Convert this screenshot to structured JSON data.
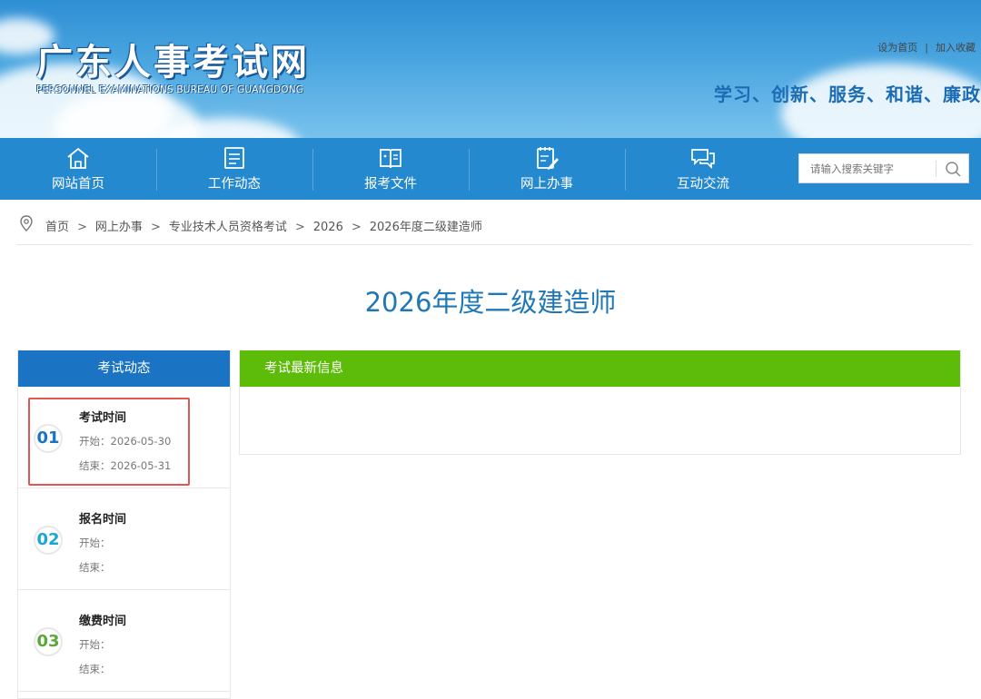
{
  "header": {
    "title": "广东人事考试网",
    "subtitle": "PERSONNEL EXAMINATIONS BUREAU OF GUANGDONG",
    "links": [
      "设为首页",
      "加入收藏"
    ],
    "link_sep": "|",
    "slogan": "学习、创新、服务、和谐、廉政"
  },
  "nav": {
    "items": [
      {
        "label": "网站首页",
        "icon": "home-icon"
      },
      {
        "label": "工作动态",
        "icon": "list-icon"
      },
      {
        "label": "报考文件",
        "icon": "book-icon"
      },
      {
        "label": "网上办事",
        "icon": "edit-doc-icon"
      },
      {
        "label": "互动交流",
        "icon": "chat-icon"
      }
    ],
    "search_placeholder": "请输入搜索关键字"
  },
  "breadcrumb": {
    "items": [
      "首页",
      "网上办事",
      "专业技术人员资格考试",
      "2026",
      "2026年度二级建造师"
    ],
    "sep": ">"
  },
  "page_title": "2026年度二级建造师",
  "sidebar": {
    "title": "考试动态",
    "rows": [
      {
        "num": "01",
        "title": "考试时间",
        "start": "开始：2026-05-30",
        "end": "结束：2026-05-31",
        "color": "#1b73c4"
      },
      {
        "num": "02",
        "title": "报名时间",
        "start": "开始：",
        "end": "结束：",
        "color": "#1aa7d6"
      },
      {
        "num": "03",
        "title": "缴费时间",
        "start": "开始：",
        "end": "结束：",
        "color": "#5aa83a"
      }
    ]
  },
  "main": {
    "title": "考试最新信息"
  },
  "colors": {
    "nav": "#2589d0",
    "sidebar_head": "#1b73c4",
    "main_head": "#5dbb09",
    "highlight": "#e05555"
  }
}
